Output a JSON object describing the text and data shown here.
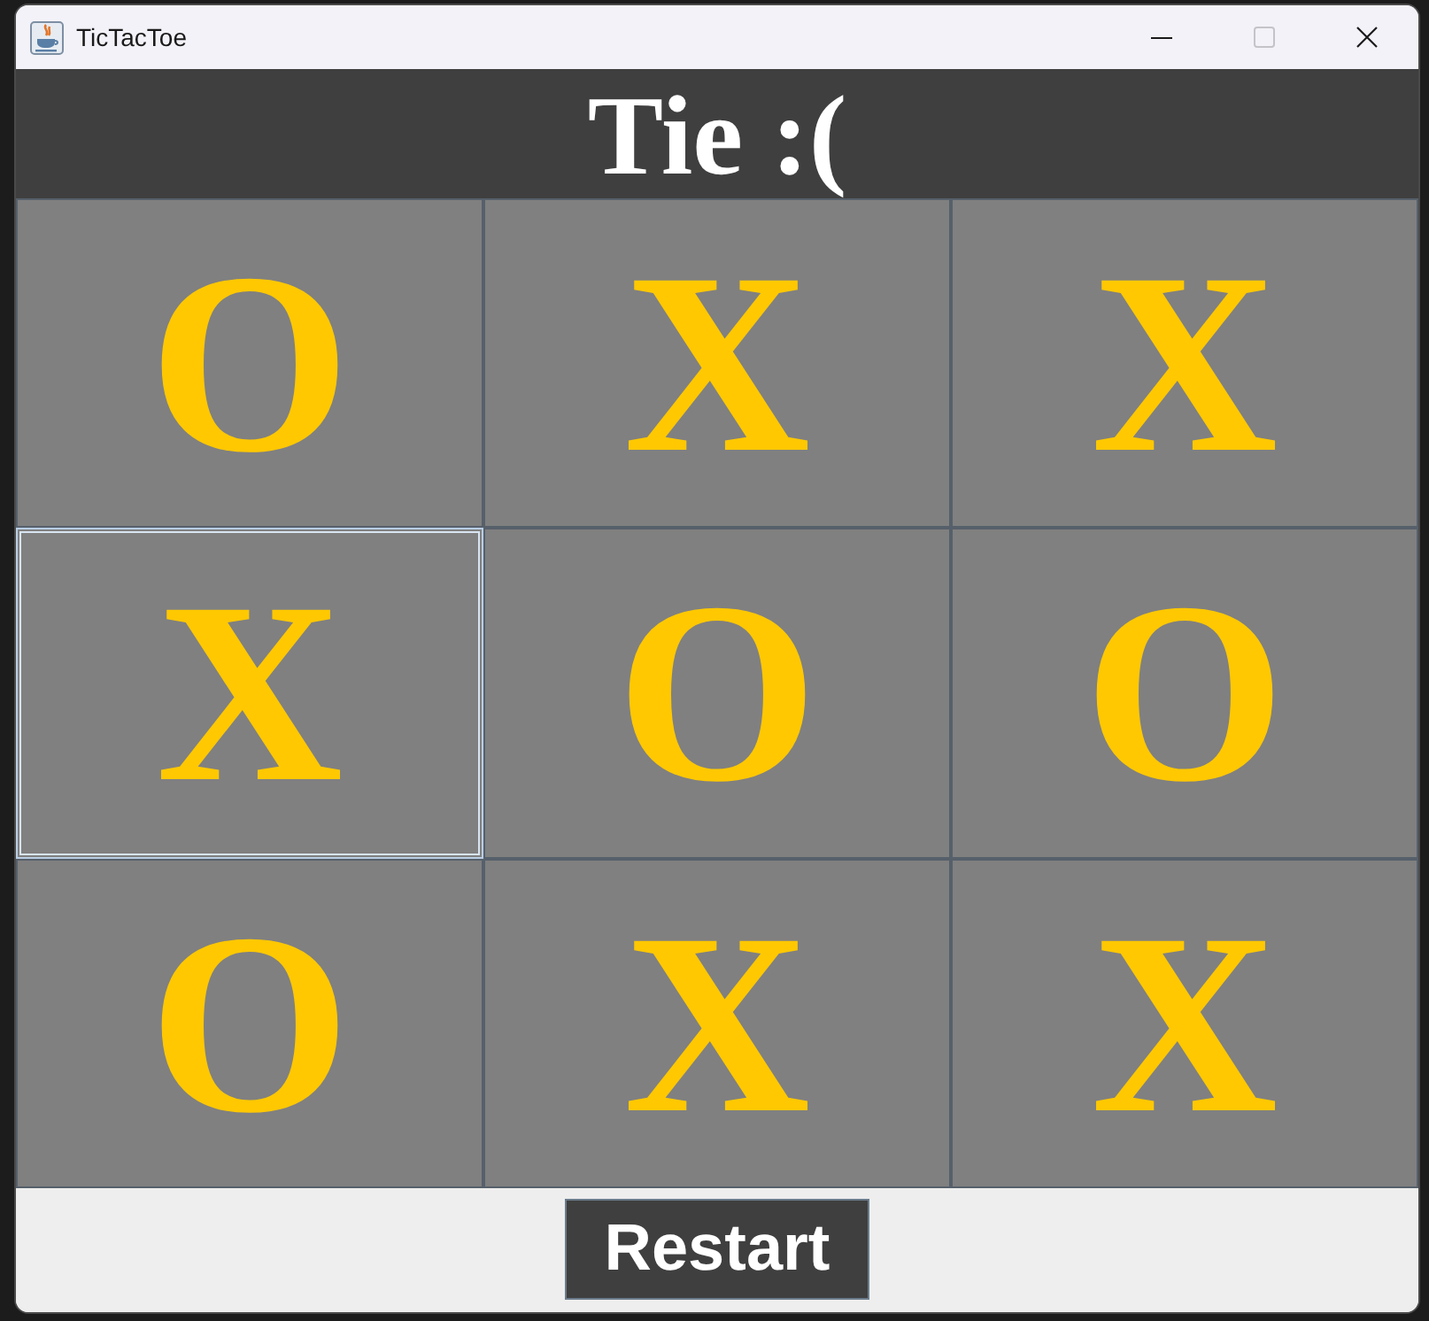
{
  "window": {
    "title": "TicTacToe"
  },
  "status": {
    "text": "Tie :("
  },
  "board": {
    "cells": [
      {
        "mark": "O",
        "focused": false
      },
      {
        "mark": "X",
        "focused": false
      },
      {
        "mark": "X",
        "focused": false
      },
      {
        "mark": "X",
        "focused": true
      },
      {
        "mark": "O",
        "focused": false
      },
      {
        "mark": "O",
        "focused": false
      },
      {
        "mark": "O",
        "focused": false
      },
      {
        "mark": "X",
        "focused": false
      },
      {
        "mark": "X",
        "focused": false
      }
    ]
  },
  "buttons": [
    {
      "label": "Restart"
    }
  ]
}
